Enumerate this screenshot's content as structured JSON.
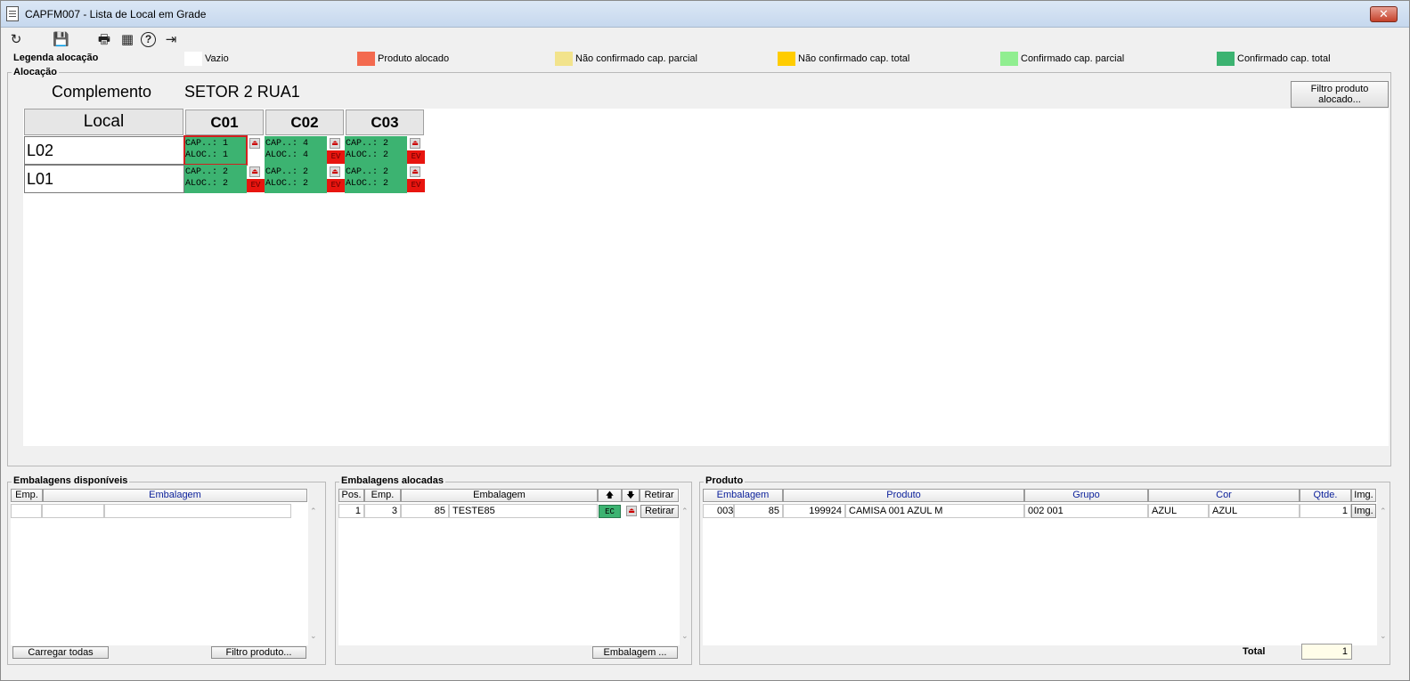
{
  "window": {
    "title": "CAPFM007 - Lista de Local em Grade",
    "close_glyph": "✕"
  },
  "toolbar": {
    "refresh_glyph": "↻",
    "save_glyph": "💾",
    "print_glyph": "🖶",
    "calendar_glyph": "▦",
    "help_glyph": "?",
    "exit_glyph": "⇥"
  },
  "legend": {
    "title": "Legenda alocação",
    "items": [
      {
        "label": "Vazio",
        "color": "#ffffff"
      },
      {
        "label": "Produto alocado",
        "color": "#f36a4f"
      },
      {
        "label": "Não confirmado cap. parcial",
        "color": "#f2e38c"
      },
      {
        "label": "Não confirmado cap. total",
        "color": "#ffcc00"
      },
      {
        "label": "Confirmado cap. parcial",
        "color": "#90ee90"
      },
      {
        "label": "Confirmado cap. total",
        "color": "#3cb371"
      }
    ]
  },
  "alocacao": {
    "title": "Alocação",
    "complemento_label": "Complemento",
    "complemento_value": "SETOR 2 RUA1",
    "filter_button": "Filtro produto alocado...",
    "grid": {
      "local_header": "Local",
      "columns": [
        "C01",
        "C02",
        "C03"
      ],
      "rows": [
        {
          "local": "L02",
          "cells": [
            {
              "cap": "CAP..: 1",
              "aloc": "ALOC.: 1",
              "ev": ""
            },
            {
              "cap": "CAP..: 4",
              "aloc": "ALOC.: 4",
              "ev": "EV"
            },
            {
              "cap": "CAP..: 2",
              "aloc": "ALOC.: 2",
              "ev": "EV"
            }
          ]
        },
        {
          "local": "L01",
          "cells": [
            {
              "cap": "CAP..: 2",
              "aloc": "ALOC.: 2",
              "ev": "EV"
            },
            {
              "cap": "CAP..: 2",
              "aloc": "ALOC.: 2",
              "ev": "EV"
            },
            {
              "cap": "CAP..: 2",
              "aloc": "ALOC.: 2",
              "ev": "EV"
            }
          ]
        }
      ]
    }
  },
  "disponiveis": {
    "title": "Embalagens disponíveis",
    "headers": {
      "emp": "Emp.",
      "embalagem": "Embalagem"
    },
    "load_all_button": "Carregar todas",
    "filter_button": "Filtro produto..."
  },
  "alocadas": {
    "title": "Embalagens alocadas",
    "headers": {
      "pos": "Pos.",
      "emp": "Emp.",
      "embalagem": "Embalagem",
      "up": "🡅",
      "down": "🡇",
      "retirar": "Retirar"
    },
    "row": {
      "pos": "1",
      "emp": "3",
      "code": "85",
      "name": "TESTE85",
      "ec": "EC",
      "retirar": "Retirar"
    },
    "embalagem_button": "Embalagem ..."
  },
  "produto": {
    "title": "Produto",
    "headers": {
      "embalagem": "Embalagem",
      "produto": "Produto",
      "grupo": "Grupo",
      "cor": "Cor",
      "qtde": "Qtde.",
      "img": "Img."
    },
    "row": {
      "emb1": "003",
      "emb2": "85",
      "codigo": "199924",
      "descricao": "CAMISA 001 AZUL M",
      "grupo": "002 001",
      "cor1": "AZUL",
      "cor2": "AZUL",
      "qtde": "1",
      "img": "Img."
    },
    "total_label": "Total",
    "total_value": "1"
  }
}
